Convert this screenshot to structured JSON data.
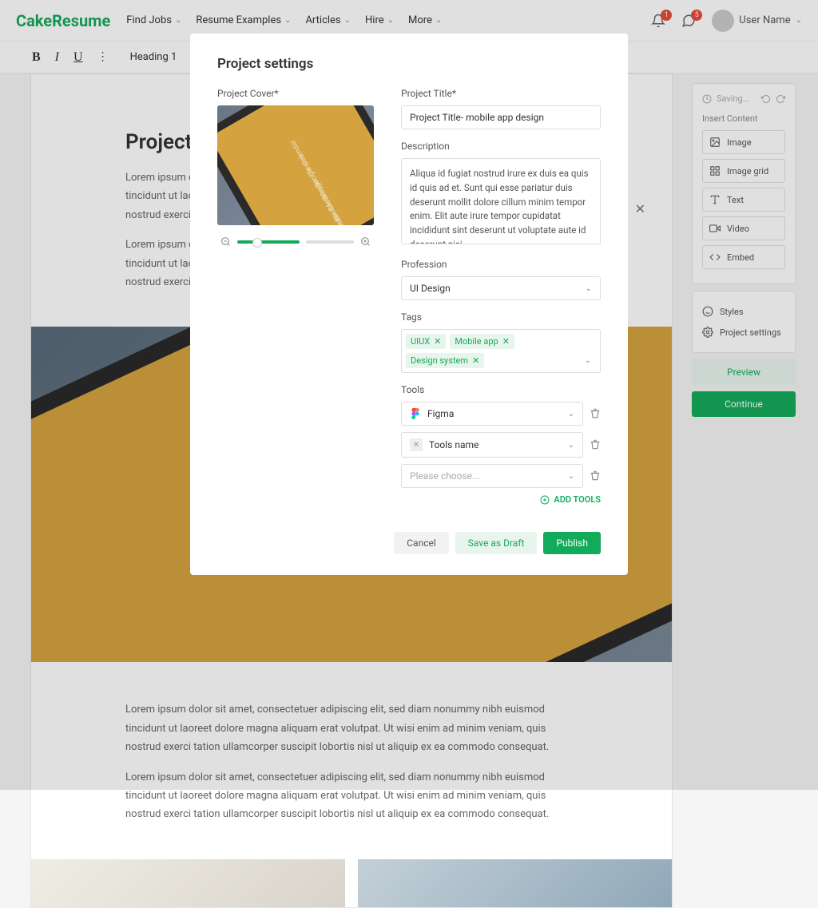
{
  "header": {
    "logo": "CakeResume",
    "nav": [
      "Find Jobs",
      "Resume Examples",
      "Articles",
      "Hire",
      "More"
    ],
    "bell_badge": "1",
    "chat_badge": "5",
    "username": "User Name"
  },
  "toolbar": {
    "heading": "Heading 1"
  },
  "doc": {
    "title": "Project Tit",
    "para1": "Lorem ipsum dolor sit amet, consectetuer adipiscing elit, sed diam nonummy nibh euismod tincidunt ut laoreet dolore magna aliquam erat volutpat. Ut wisi enim ad minim veniam, quis nostrud exerci tation ullamcorper suscipit lobortis nisl ut aliquip ex ea commodo consequat.",
    "para2": "Lorem ipsum dolor sit amet, consectetuer adipiscing elit, sed diam nonummy nibh euismod tincidunt ut laoreet dolore magna aliquam erat volutpat. Ut wisi enim ad minim veniam, quis nostrud exerci tation ullamcorper suscipit lobortis nisl ut aliquip ex ea commodo consequat.",
    "para3": "Lorem ipsum dolor sit amet, consectetuer adipiscing elit, sed diam nonummy nibh euismod tincidunt ut laoreet dolore magna aliquam erat volutpat. Ut wisi enim ad minim veniam, quis nostrud exerci tation ullamcorper suscipit lobortis nisl ut aliquip ex ea commodo consequat.",
    "para4": "Lorem ipsum dolor sit amet, consectetuer adipiscing elit, sed diam nonummy nibh euismod tincidunt ut laoreet dolore magna aliquam erat volutpat. Ut wisi enim ad minim veniam, quis nostrud exerci tation ullamcorper suscipit lobortis nisl ut aliquip ex ea commodo consequat."
  },
  "side": {
    "saving": "Saving...",
    "section": "Insert Content",
    "items": [
      "Image",
      "Image grid",
      "Text",
      "Video",
      "Embed"
    ],
    "styles": "Styles",
    "settings": "Project settings",
    "preview": "Preview",
    "continue": "Continue"
  },
  "modal": {
    "title": "Project settings",
    "cover_label": "Project Cover*",
    "title_label": "Project Title*",
    "title_value": "Project Title- mobile app design",
    "desc_label": "Description",
    "desc_value": "Aliqua id fugiat nostrud irure ex duis ea quis id quis ad et. Sunt qui esse pariatur duis deserunt mollit dolore cillum minim tempor enim. Elit aute irure tempor cupidatat incididunt sint deserunt ut voluptate aute id deserunt nisi.",
    "profession_label": "Profession",
    "profession_value": "UI Design",
    "tags_label": "Tags",
    "tags": [
      "UIUX",
      "Mobile app",
      "Design system"
    ],
    "tools_label": "Tools",
    "tool1": "Figma",
    "tool2": "Tools name",
    "tool3_placeholder": "Please choose...",
    "add_tools": "ADD TOOLS",
    "cancel": "Cancel",
    "draft": "Save as Draft",
    "publish": "Publish"
  }
}
